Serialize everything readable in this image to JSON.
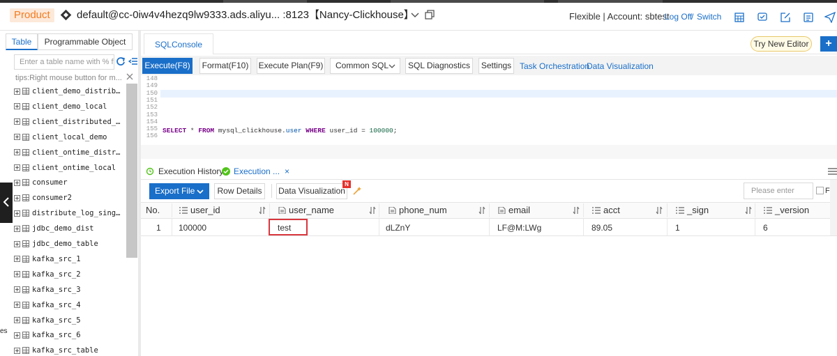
{
  "header": {
    "product": "Product",
    "connection": "default@cc-0iw4v4hezq9lw9333.ads.aliyu... :8123【Nancy-Clickhouse】",
    "account": "Flexible | Account: sbtest",
    "log_off": "Log Off",
    "slash": "/",
    "switch": "Switch"
  },
  "left": {
    "tabs": [
      "Table",
      "Programmable Object"
    ],
    "search_placeholder": "Enter a table name with % f",
    "tips": "tips:Right mouse button for m...",
    "tables": [
      "client_demo_distributed",
      "client_demo_local",
      "client_distributed_on…",
      "client_local_demo",
      "client_ontime_distrib…",
      "client_ontime_local",
      "consumer",
      "consumer2",
      "distribute_log_single…",
      "jdbc_demo_dist",
      "jdbc_demo_table",
      "kafka_src_1",
      "kafka_src_2",
      "kafka_src_3",
      "kafka_src_4",
      "kafka_src_5",
      "kafka_src_6",
      "kafka_src_table"
    ],
    "edge_text": "es"
  },
  "console": {
    "tab": "SQLConsole",
    "try_new_editor": "Try New Editor",
    "plus": "+"
  },
  "toolbar": {
    "execute": "Execute(F8)",
    "format": "Format(F10)",
    "plan": "Execute Plan(F9)",
    "common_sql": "Common SQL",
    "diagnostics": "SQL Diagnostics",
    "settings": "Settings",
    "task_orchestration": "Task Orchestration",
    "data_visualization": "Data Visualization"
  },
  "editor": {
    "line_numbers": [
      "148",
      "149",
      "150",
      "151",
      "152",
      "153",
      "154",
      "155",
      "156"
    ],
    "sql": {
      "select": "SELECT",
      "star": "*",
      "from": "FROM",
      "table": "mysql_clickhouse.",
      "table_user": "user",
      "where": "WHERE",
      "cond": "user_id =",
      "value": "100000",
      "end": ";"
    }
  },
  "results": {
    "history_tab": "Execution History",
    "execution_tab": "Execution ...",
    "close": "×",
    "export_file": "Export File",
    "row_details": "Row Details",
    "data_visualization": "Data Visualization",
    "new_badge": "N",
    "filter_placeholder": "Please enter",
    "filter_label": "Filte",
    "columns": [
      "No.",
      "user_id",
      "user_name",
      "phone_num",
      "email",
      "acct",
      "_sign",
      "_version"
    ],
    "rows": [
      [
        "1",
        "100000",
        "test",
        "dLZnY",
        "LF@M:LWg",
        "89.05",
        "1",
        "6"
      ]
    ]
  },
  "colors": {
    "accent": "#1a6fc9",
    "product_bg": "#fde9da",
    "product_text": "#f47c20",
    "highlight_box": "#d9363e"
  }
}
